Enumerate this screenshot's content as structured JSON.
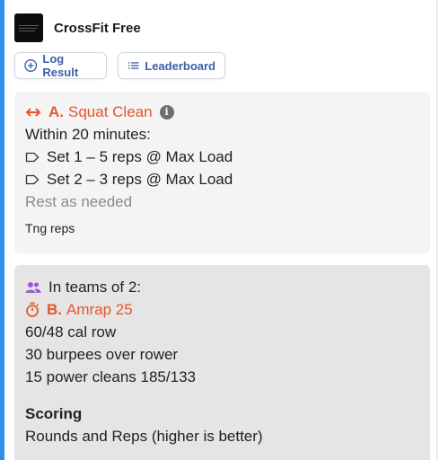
{
  "app": {
    "title": "CrossFit Free"
  },
  "actions": {
    "log_result": "Log Result",
    "leaderboard": "Leaderboard"
  },
  "workout_a": {
    "letter": "A.",
    "name": "Squat Clean",
    "duration": "Within 20 minutes:",
    "sets": [
      "Set 1 – 5 reps @ Max Load",
      "Set 2 – 3 reps @ Max Load"
    ],
    "rest": "Rest as needed",
    "note": "Tng reps"
  },
  "workout_b": {
    "team_text": "In teams of 2:",
    "letter": "B.",
    "name": "Amrap 25",
    "movements": [
      "60/48 cal row",
      "30 burpees over rower",
      "15 power cleans 185/133"
    ],
    "scoring_label": "Scoring",
    "scoring_value": "Rounds and Reps (higher is better)"
  },
  "colors": {
    "accent": "#e4572e",
    "primary_link": "#3d5fa8",
    "team_icon": "#9b59d0",
    "left_bar": "#2f8ee8"
  },
  "icons": {
    "log": "plus-circle-icon",
    "leaderboard": "list-icon",
    "workout_a": "arrows-horizontal-icon",
    "info": "info-icon",
    "set": "tag-icon",
    "team": "people-icon",
    "timer": "stopwatch-icon"
  }
}
